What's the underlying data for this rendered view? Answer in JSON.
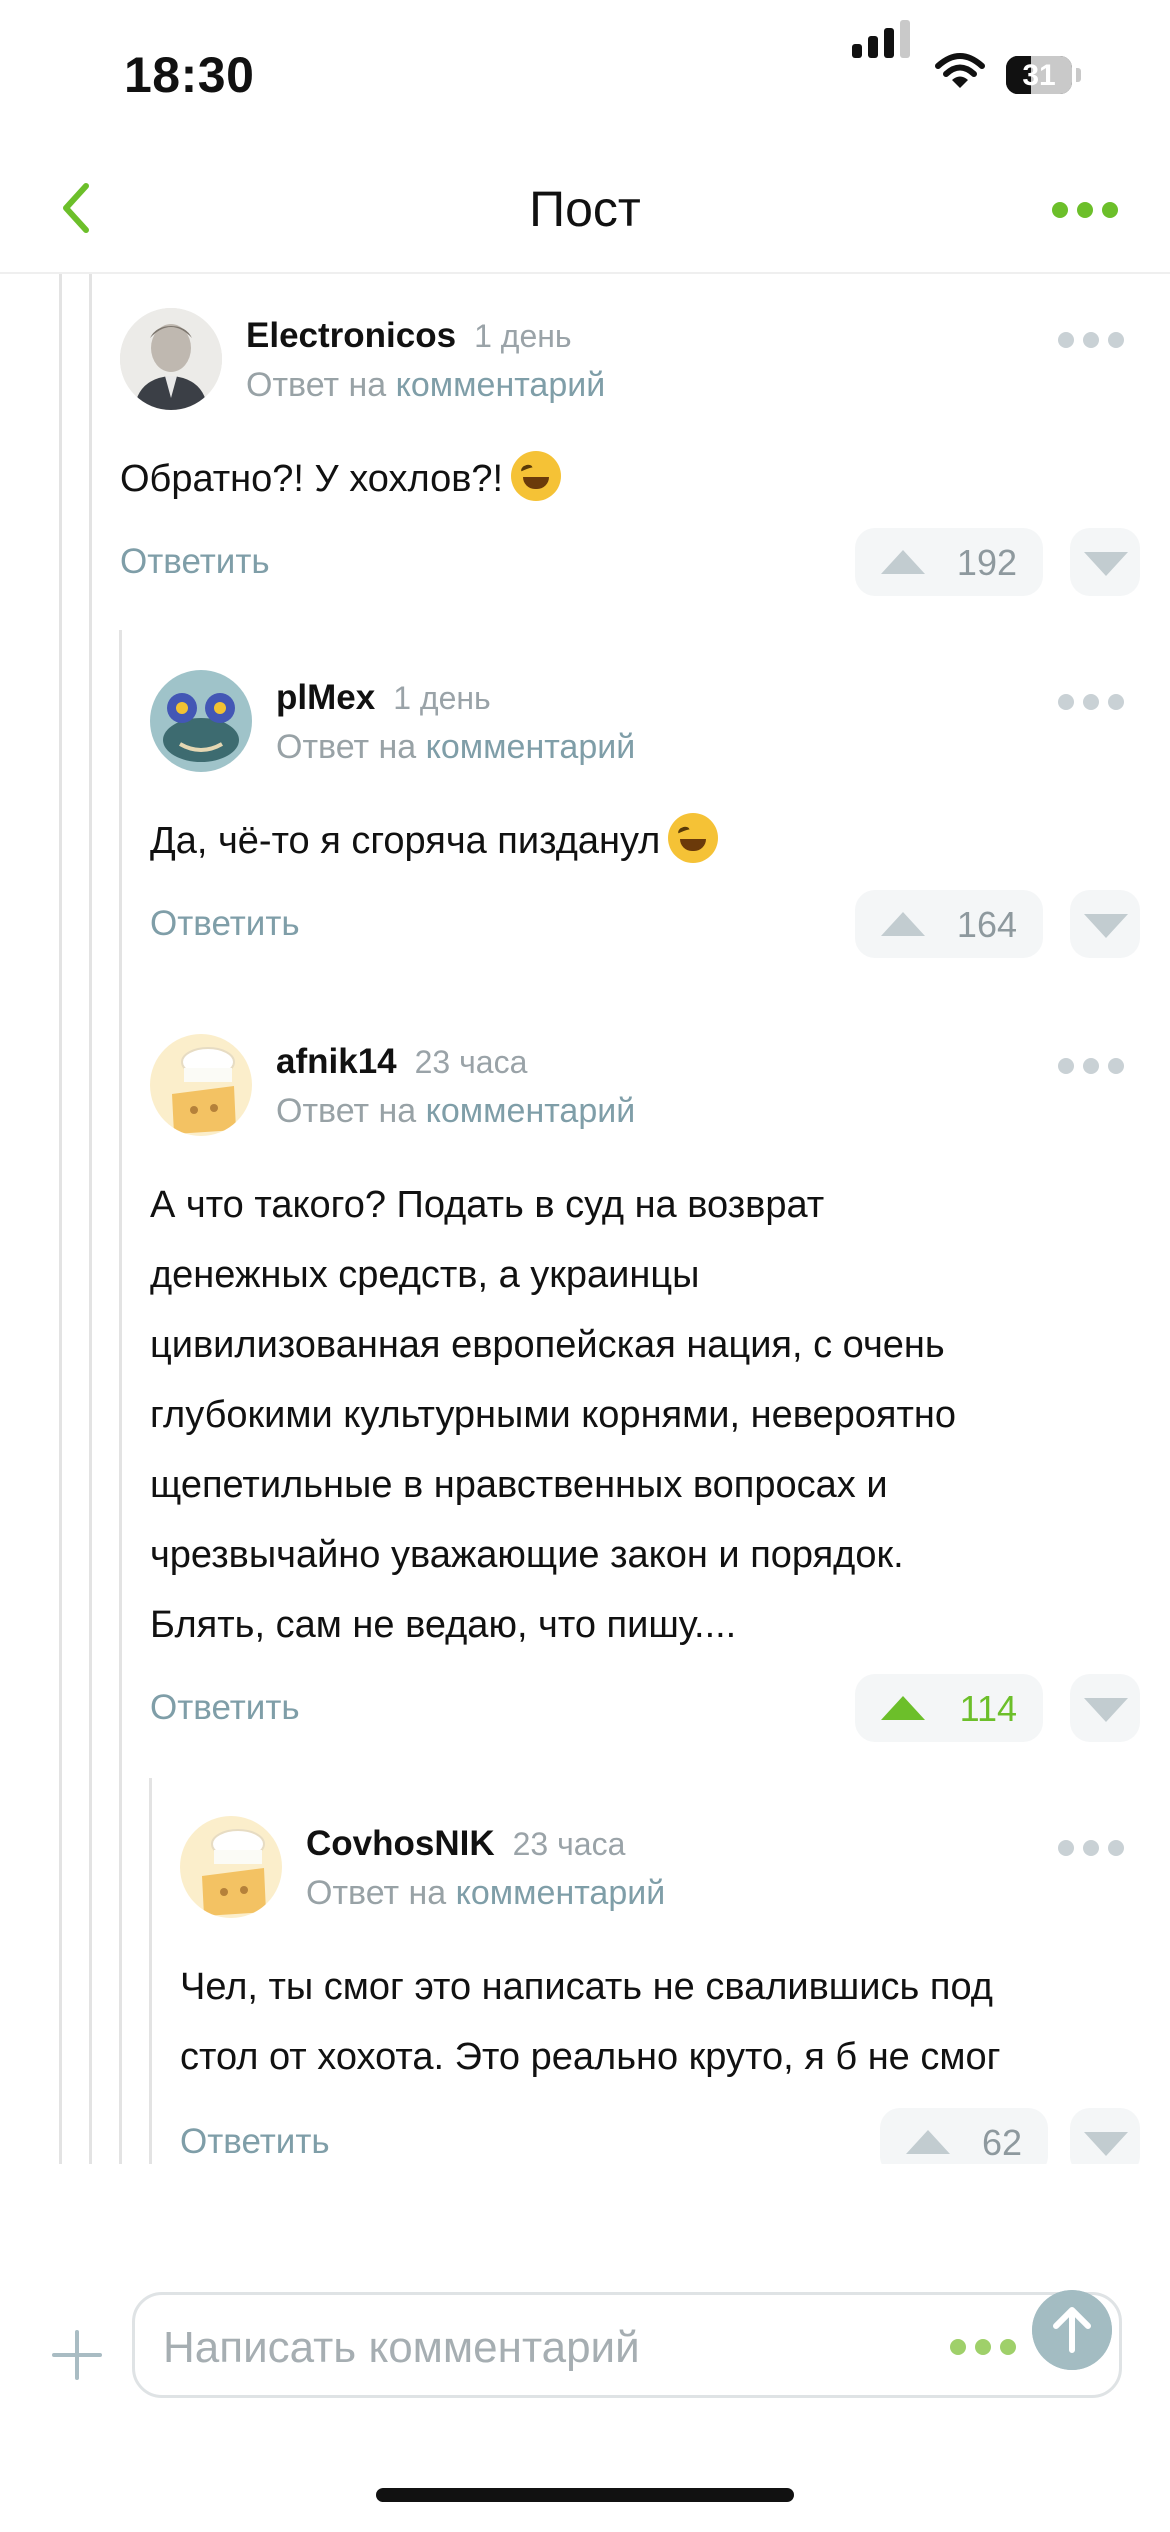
{
  "status_bar": {
    "time": "18:30",
    "battery": "31",
    "battery_level": 0.31
  },
  "header": {
    "title": "Пост",
    "back_icon": "chevron-left-icon",
    "more_icon": "more-dots-icon",
    "accent": "#6cbf2a"
  },
  "comments": [
    {
      "user": "Electronicos",
      "time": "1 день",
      "reply_prefix": "Ответ на",
      "reply_link": "комментарий",
      "text": "Обратно?! У хохлов?!",
      "reply_label": "Ответить",
      "votes": "192",
      "upvoted": false
    },
    {
      "user": "plMex",
      "time": "1 день",
      "reply_prefix": "Ответ на",
      "reply_link": "комментарий",
      "text": "Да, чё-то я сгоряча пизданул",
      "reply_label": "Ответить",
      "votes": "164",
      "upvoted": false
    },
    {
      "user": "afnik14",
      "time": "23 часа",
      "reply_prefix": "Ответ на",
      "reply_link": "комментарий",
      "text_lines": [
        "А что такого? Подать в суд на возврат",
        "денежных средств, а украинцы",
        "цивилизованная европейская нация, с очень",
        "глубокими культурными корнями, невероятно",
        "щепетильные в нравственных вопросах и",
        "чрезвычайно уважающие закон и порядок.",
        "Блять, сам не ведаю, что пишу...."
      ],
      "reply_label": "Ответить",
      "votes": "114",
      "upvoted": true
    },
    {
      "user": "CovhosNIK",
      "time": "23 часа",
      "reply_prefix": "Ответ на",
      "reply_link": "комментарий",
      "text_lines": [
        "Чел, ты смог это написать не свалившись под",
        "стол от хохота. Это реально круто, я б не смог"
      ],
      "reply_label": "Ответить",
      "votes": "62",
      "upvoted": false
    }
  ],
  "composer": {
    "placeholder": "Написать комментарий",
    "send_icon": "arrow-up-icon",
    "plus_icon": "plus-icon"
  }
}
